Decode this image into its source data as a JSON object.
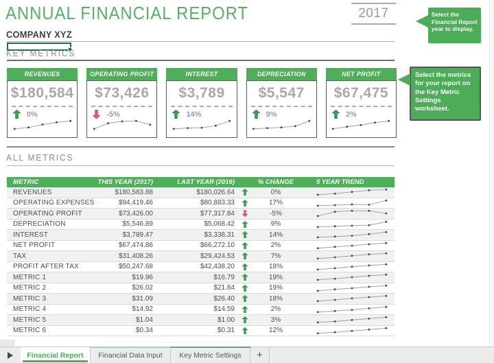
{
  "header": {
    "title": "ANNUAL FINANCIAL REPORT",
    "company": "COMPANY XYZ",
    "year": "2017"
  },
  "callouts": {
    "year": "Select the Financial Report year to display.",
    "metrics": "Select the metrics for your report on the Key Metric Settings worksheet."
  },
  "sections": {
    "key_metrics": "KEY METRICS",
    "all_metrics": "ALL METRICS"
  },
  "colors": {
    "accent_green": "#4eae5a",
    "callout_green": "#4cac58",
    "selection_green": "#1d6f42",
    "positive_arrow": "#3ba04e",
    "negative_arrow": "#e05c5c",
    "value_gray": "#a8a8a8"
  },
  "cards": [
    {
      "label": "REVENUES",
      "value": "$180,584",
      "change": "0%",
      "direction": "up",
      "trend": [
        3,
        3.4,
        4.2,
        4.8,
        5.2
      ]
    },
    {
      "label": "OPERATING PROFIT",
      "value": "$73,426",
      "change": "-5%",
      "direction": "down",
      "trend": [
        3,
        4.2,
        4.6,
        4.7,
        3.9
      ]
    },
    {
      "label": "INTEREST",
      "value": "$3,789",
      "change": "14%",
      "direction": "up",
      "trend": [
        3,
        3.2,
        3.3,
        3.8,
        5
      ]
    },
    {
      "label": "DEPRECIATION",
      "value": "$5,547",
      "change": "9%",
      "direction": "up",
      "trend": [
        3,
        3.2,
        3.4,
        3.7,
        5.1
      ]
    },
    {
      "label": "NET PROFIT",
      "value": "$67,475",
      "change": "2%",
      "direction": "up",
      "trend": [
        3,
        3.5,
        3.9,
        4.5,
        4.9
      ]
    }
  ],
  "table": {
    "headers": [
      "METRIC",
      "THIS YEAR (2017)",
      "LAST YEAR (2016)",
      "% CHANGE",
      "5 YEAR TREND"
    ],
    "rows": [
      {
        "metric": "REVENUES",
        "this_year": "$180,583.88",
        "last_year": "$180,026.64",
        "direction": "up",
        "change": "0%",
        "trend": [
          3,
          3.5,
          4.2,
          4.9,
          5.2
        ]
      },
      {
        "metric": "OPERATING EXPENSES",
        "this_year": "$94,419.46",
        "last_year": "$80,883.33",
        "direction": "up",
        "change": "17%",
        "trend": [
          3,
          3.2,
          3.5,
          3.4,
          5
        ]
      },
      {
        "metric": "OPERATING PROFIT",
        "this_year": "$73,426.00",
        "last_year": "$77,317.84",
        "direction": "down",
        "change": "-5%",
        "trend": [
          3,
          4.3,
          4.6,
          4.6,
          3.8
        ]
      },
      {
        "metric": "DEPRECIATION",
        "this_year": "$5,546.89",
        "last_year": "$5,068.42",
        "direction": "up",
        "change": "9%",
        "trend": [
          3,
          3.3,
          3.5,
          3.7,
          5
        ]
      },
      {
        "metric": "INTEREST",
        "this_year": "$3,789.47",
        "last_year": "$3,338.31",
        "direction": "up",
        "change": "14%",
        "trend": [
          3,
          3.3,
          3.6,
          4.2,
          5
        ]
      },
      {
        "metric": "NET PROFIT",
        "this_year": "$67,474.86",
        "last_year": "$66,272.10",
        "direction": "up",
        "change": "2%",
        "trend": [
          2.8,
          3.4,
          3.9,
          4.5,
          5
        ]
      },
      {
        "metric": "TAX",
        "this_year": "$31,408.26",
        "last_year": "$29,424.53",
        "direction": "up",
        "change": "7%",
        "trend": [
          2.9,
          3.4,
          4,
          4.6,
          5
        ]
      },
      {
        "metric": "PROFIT AFTER TAX",
        "this_year": "$50,247.68",
        "last_year": "$42,438.20",
        "direction": "up",
        "change": "18%",
        "trend": [
          2.8,
          3.4,
          4.1,
          4.7,
          5.2
        ]
      },
      {
        "metric": "METRIC 1",
        "this_year": "$19.96",
        "last_year": "$16.79",
        "direction": "up",
        "change": "19%",
        "trend": [
          2.9,
          3.4,
          4,
          4.6,
          5.1
        ]
      },
      {
        "metric": "METRIC 2",
        "this_year": "$26.02",
        "last_year": "$21.84",
        "direction": "up",
        "change": "19%",
        "trend": [
          2.9,
          3.5,
          4,
          4.6,
          5.1
        ]
      },
      {
        "metric": "METRIC 3",
        "this_year": "$31.09",
        "last_year": "$26.40",
        "direction": "up",
        "change": "18%",
        "trend": [
          3,
          3.5,
          4.1,
          4.6,
          5.1
        ]
      },
      {
        "metric": "METRIC 4",
        "this_year": "$14.92",
        "last_year": "$14.59",
        "direction": "up",
        "change": "2%",
        "trend": [
          3,
          3.3,
          3.6,
          4,
          4.4
        ]
      },
      {
        "metric": "METRIC 5",
        "this_year": "$1.04",
        "last_year": "$1.00",
        "direction": "up",
        "change": "3%",
        "trend": [
          3,
          3.2,
          3.5,
          3.8,
          4.1
        ]
      },
      {
        "metric": "METRIC 6",
        "this_year": "$0.34",
        "last_year": "$0.31",
        "direction": "up",
        "change": "12%",
        "trend": [
          2.9,
          3.3,
          3.8,
          4.3,
          4.8
        ]
      }
    ]
  },
  "sheet_tabs": {
    "tabs": [
      {
        "label": "Financial Report",
        "active": true
      },
      {
        "label": "Financial Data Input",
        "active": false
      },
      {
        "label": "Key Metric Settings",
        "active": false
      }
    ],
    "add_label": "+"
  }
}
